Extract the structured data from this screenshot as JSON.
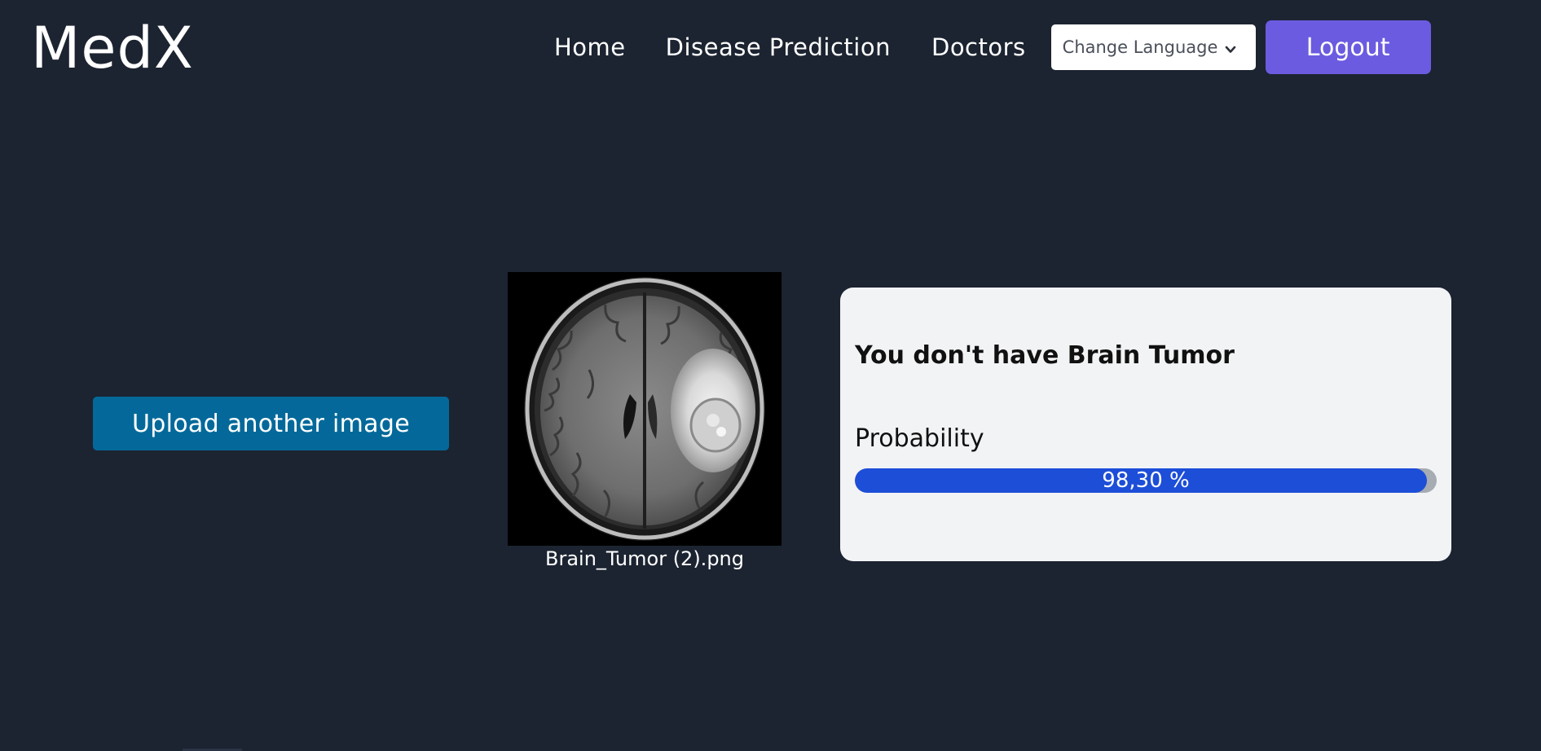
{
  "header": {
    "logo": "MedX",
    "nav": [
      {
        "label": "Home"
      },
      {
        "label": "Disease Prediction"
      },
      {
        "label": "Doctors"
      }
    ],
    "language_select": "Change Language",
    "logout_label": "Logout"
  },
  "main": {
    "upload_button": "Upload another image",
    "image_filename": "Brain_Tumor (2).png",
    "result": {
      "title": "You don't have Brain Tumor",
      "probability_label": "Probability",
      "probability_text": "98,30 %",
      "probability_value": 98.3
    }
  },
  "colors": {
    "background": "#1c2431",
    "logout": "#6b5be0",
    "upload": "#04699a",
    "progress": "#1d4ed8"
  },
  "icons": [
    "chevron-down-icon"
  ]
}
